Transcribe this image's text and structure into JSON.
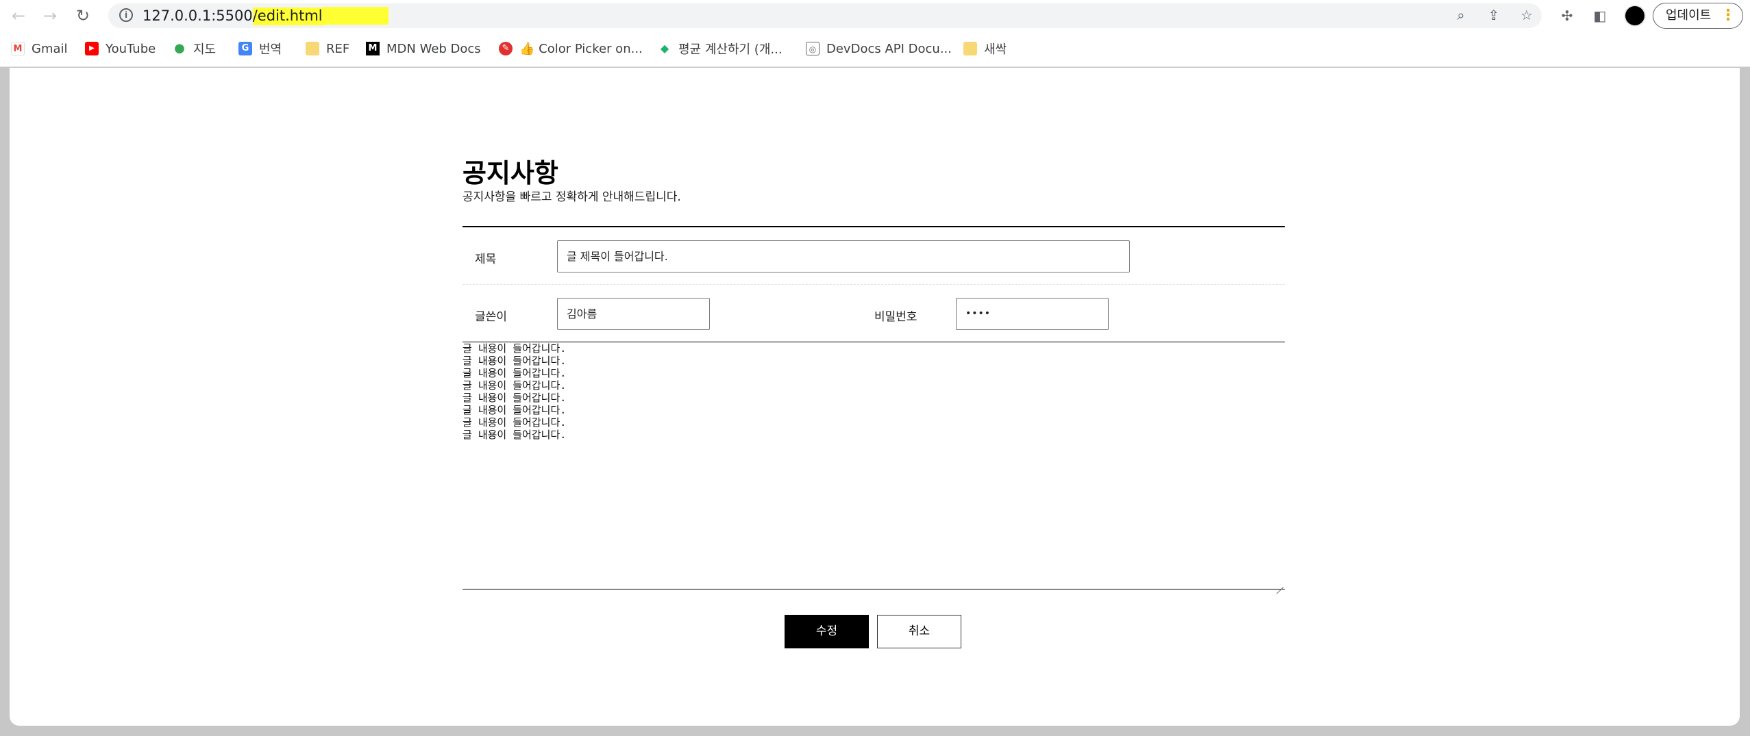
{
  "browser": {
    "url_host": "127.0.0.1:5500",
    "url_path": "/edit.html",
    "update_label": "업데이트"
  },
  "bookmarks": [
    {
      "label": "Gmail",
      "icon": "gmail-icon",
      "color": "#ea4335",
      "glyph": "M"
    },
    {
      "label": "YouTube",
      "icon": "youtube-icon",
      "color": "#ff0000",
      "glyph": "▶"
    },
    {
      "label": "지도",
      "icon": "maps-icon",
      "color": "#34a853",
      "glyph": "●"
    },
    {
      "label": "번역",
      "icon": "translate-icon",
      "color": "#4285f4",
      "glyph": "G"
    },
    {
      "label": "REF",
      "icon": "folder-icon",
      "color": "#f8d775",
      "glyph": ""
    },
    {
      "label": "MDN Web Docs",
      "icon": "mdn-icon",
      "color": "#000000",
      "glyph": "M"
    },
    {
      "label": "👍 Color Picker on...",
      "icon": "color-picker-icon",
      "color": "#e03030",
      "glyph": "✎"
    },
    {
      "label": "평균 계산하기 (개...",
      "icon": "calculator-icon",
      "color": "#1db36b",
      "glyph": "◆"
    },
    {
      "label": "DevDocs API Docu...",
      "icon": "devdocs-icon",
      "color": "#5f6368",
      "glyph": "◎"
    },
    {
      "label": "새싹",
      "icon": "folder-icon",
      "color": "#f8d775",
      "glyph": ""
    }
  ],
  "page": {
    "title": "공지사항",
    "subtitle": "공지사항을 빠르고 정확하게 안내해드립니다.",
    "fields": {
      "title_label": "제목",
      "title_value": "글 제목이 들어갑니다.",
      "writer_label": "글쓴이",
      "writer_value": "김아름",
      "password_label": "비밀번호",
      "password_value": "••••"
    },
    "content_lines": [
      "글 내용이 들어갑니다.",
      "글 내용이 들어갑니다.",
      "글 내용이 들어갑니다.",
      "글 내용이 들어갑니다.",
      "글 내용이 들어갑니다.",
      "글 내용이 들어갑니다.",
      "글 내용이 들어갑니다.",
      "글 내용이 들어갑니다."
    ],
    "buttons": {
      "submit": "수정",
      "cancel": "취소"
    }
  },
  "colors": {
    "primary_button_bg": "#000000",
    "url_highlight": "#ffff33"
  }
}
